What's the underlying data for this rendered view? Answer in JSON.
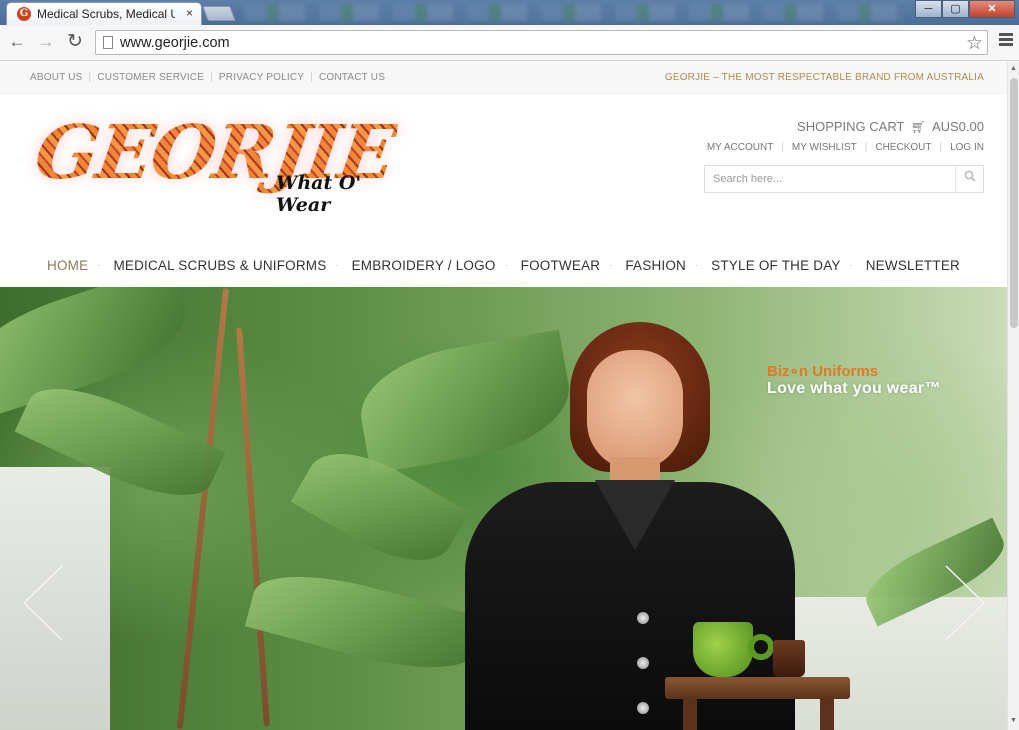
{
  "browser": {
    "tab_title": "Medical Scrubs, Medical U",
    "tab_close": "×",
    "url": "www.georjie.com",
    "favicon_letter": "G",
    "buttons": {
      "back": "←",
      "forward": "→",
      "reload": "↻",
      "star": "☆"
    },
    "window": {
      "minimize": "─",
      "maximize": "▢",
      "close": "✕"
    }
  },
  "topbar": {
    "links": [
      {
        "label": "ABOUT US"
      },
      {
        "label": "CUSTOMER SERVICE"
      },
      {
        "label": "PRIVACY POLICY"
      },
      {
        "label": "CONTACT US"
      }
    ],
    "tagline": "GEORJIE – THE MOST RESPECTABLE BRAND FROM AUSTRALIA"
  },
  "header": {
    "logo_text": "GEORJIE",
    "logo_subtitle": "What O' Wear",
    "cart_label": "SHOPPING CART",
    "cart_amount": "AUS0.00",
    "account_links": [
      {
        "label": "MY ACCOUNT"
      },
      {
        "label": "MY WISHLIST"
      },
      {
        "label": "CHECKOUT"
      },
      {
        "label": "LOG IN"
      }
    ],
    "search_placeholder": "Search here..."
  },
  "nav": [
    {
      "label": "HOME",
      "active": true
    },
    {
      "label": "MEDICAL SCRUBS & UNIFORMS"
    },
    {
      "label": "EMBROIDERY / LOGO"
    },
    {
      "label": "FOOTWEAR"
    },
    {
      "label": "FASHION"
    },
    {
      "label": "STYLE OF THE DAY"
    },
    {
      "label": "NEWSLETTER"
    }
  ],
  "hero": {
    "brand": "Biz∘n Uniforms",
    "slogan": "Love what you wear™"
  },
  "colors": {
    "accent_gold": "#b08a4d",
    "nav_active": "#8c7a58",
    "promo_orange": "#e07a26"
  }
}
